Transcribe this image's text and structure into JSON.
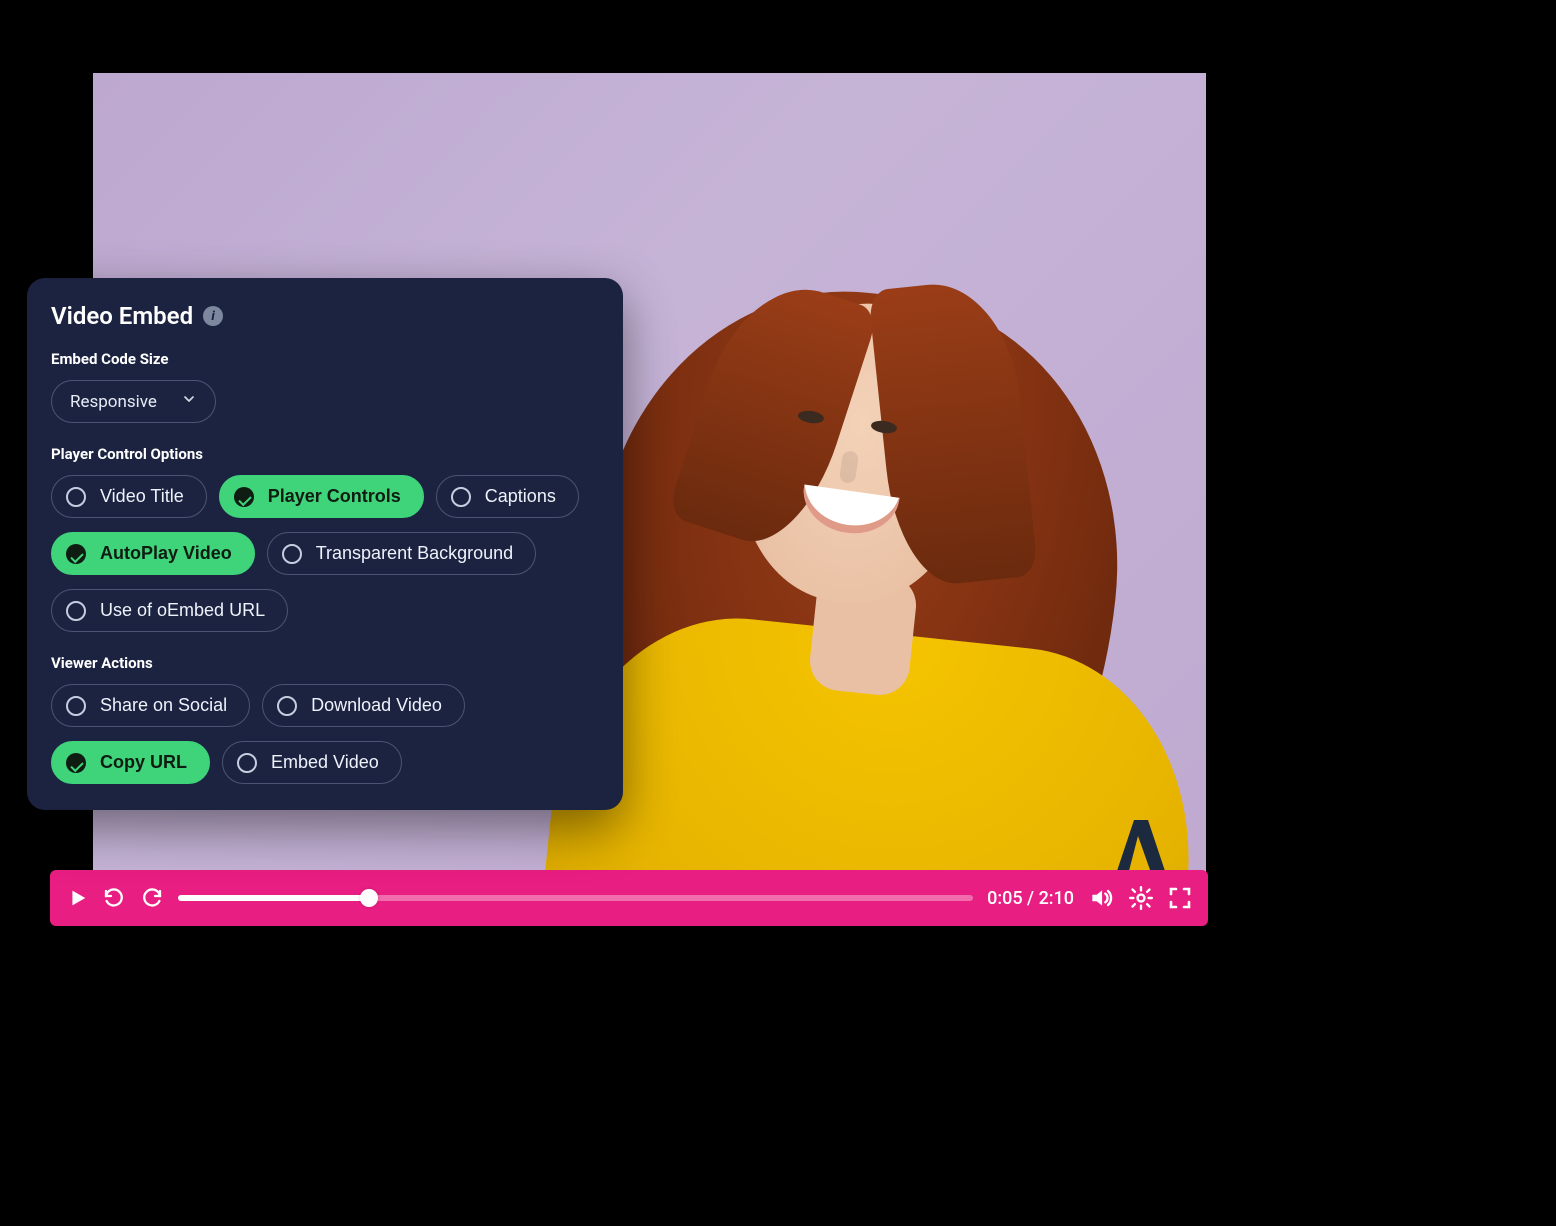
{
  "panel": {
    "title": "Video Embed",
    "info_icon": "i",
    "embed_size": {
      "label": "Embed Code Size",
      "selected": "Responsive"
    },
    "player_options": {
      "label": "Player Control Options",
      "items": [
        {
          "id": "video-title",
          "label": "Video Title",
          "selected": false
        },
        {
          "id": "player-controls",
          "label": "Player Controls",
          "selected": true
        },
        {
          "id": "captions",
          "label": "Captions",
          "selected": false
        },
        {
          "id": "autoplay-video",
          "label": "AutoPlay Video",
          "selected": true
        },
        {
          "id": "transparent-bg",
          "label": "Transparent Background",
          "selected": false
        },
        {
          "id": "oembed-url",
          "label": "Use of oEmbed URL",
          "selected": false
        }
      ]
    },
    "viewer_actions": {
      "label": "Viewer Actions",
      "items": [
        {
          "id": "share-social",
          "label": "Share on Social",
          "selected": false
        },
        {
          "id": "download-video",
          "label": "Download Video",
          "selected": false
        },
        {
          "id": "copy-url",
          "label": "Copy URL",
          "selected": true
        },
        {
          "id": "embed-video",
          "label": "Embed Video",
          "selected": false
        }
      ]
    }
  },
  "player": {
    "current_time": "0:05",
    "duration": "2:10",
    "time_separator": " / ",
    "progress_pct": 24,
    "bar_color": "#e91e82"
  },
  "colors": {
    "panel_bg": "#1b2340",
    "accent_green": "#3fd37a",
    "video_bg": "#bda8d0",
    "brand_dot": "#d11a6b",
    "brand_stroke": "#1b2a3f"
  },
  "icons": {
    "play": "play-icon",
    "rewind": "rewind-icon",
    "forward": "forward-icon",
    "volume": "volume-icon",
    "settings_gear": "gear-icon",
    "fullscreen": "fullscreen-icon",
    "info": "info-icon",
    "chevron_down": "chevron-down-icon"
  }
}
